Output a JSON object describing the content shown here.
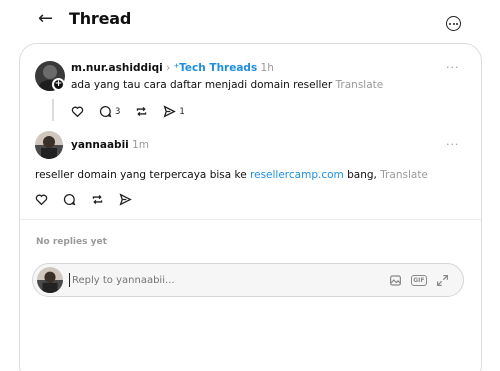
{
  "header": {
    "back_icon": "arrow-left-icon",
    "title": "Thread",
    "more_icon": "ellipsis-circle-icon"
  },
  "parent_post": {
    "username": "m.nur.ashiddiqi",
    "separator": "›",
    "community_icon": "tech-threads-icon",
    "community": "Tech Threads",
    "time": "1h",
    "text": "ada yang tau cara daftar menjadi domain reseller",
    "translate": "Translate",
    "more": "···",
    "likes": "",
    "replies": "3",
    "reposts": "",
    "shares": "1"
  },
  "reply_post": {
    "username": "yannaabii",
    "time": "1m",
    "text_before": "reseller domain yang terpercaya bisa ke ",
    "link": "resellercamp.com",
    "text_after": " bang,",
    "translate": "Translate",
    "more": "···"
  },
  "replies_status": "No replies yet",
  "composer": {
    "placeholder": "Reply to yannaabii...",
    "icons": [
      "image-icon",
      "gif-icon",
      "expand-icon"
    ],
    "gif_label": "GIF"
  },
  "colors": {
    "accent": "#1d8fe1",
    "muted": "#9a9a9a",
    "border": "#dcdcdc"
  }
}
